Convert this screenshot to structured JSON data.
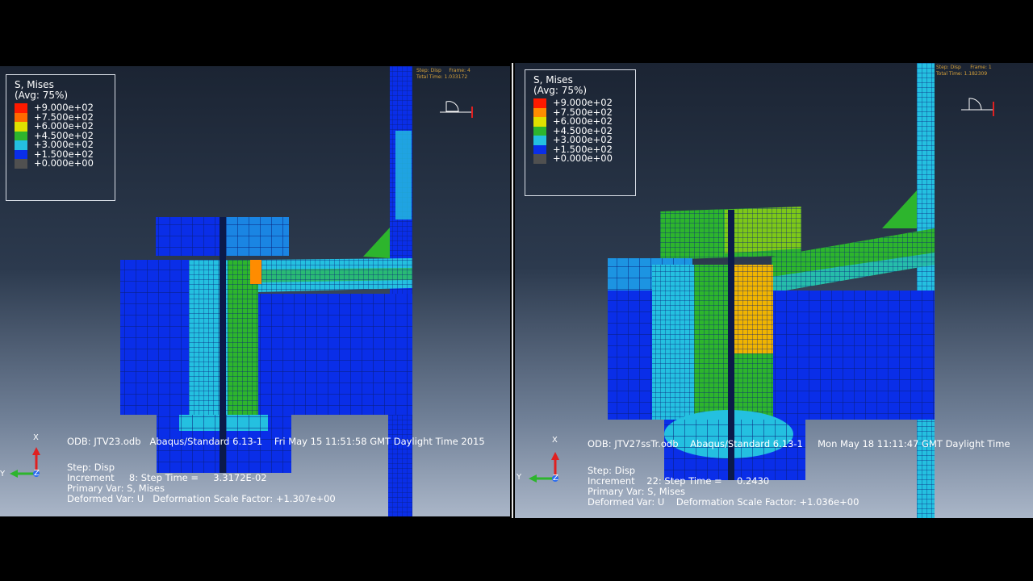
{
  "left": {
    "legend": {
      "title": "S, Mises",
      "subtitle": "(Avg: 75%)",
      "entries": [
        "+9.000e+02",
        "+7.500e+02",
        "+6.000e+02",
        "+4.500e+02",
        "+3.000e+02",
        "+1.500e+02",
        "+0.000e+00"
      ],
      "colors": [
        "#ff1a00",
        "#ff6a00",
        "#e0e000",
        "#2db52d",
        "#24c0e0",
        "#0a2ee8",
        "#505050"
      ]
    },
    "header": {
      "step": "Step: Disp     Frame: 4",
      "total": "Total Time: 1.033172"
    },
    "odb_line": "ODB: JTV23.odb   Abaqus/Standard 6.13-1    Fri May 15 11:51:58 GMT Daylight Time 2015",
    "step_line": "Step: Disp",
    "increment_line": "Increment     8: Step Time =     3.3172E-02",
    "primary_var": "Primary Var: S, Mises",
    "deformed_var": "Deformed Var: U   Deformation Scale Factor: +1.307e+00",
    "triad": {
      "x": "X",
      "y": "Y",
      "z": "Z"
    }
  },
  "right": {
    "legend": {
      "title": "S, Mises",
      "subtitle": "(Avg: 75%)",
      "entries": [
        "+9.000e+02",
        "+7.500e+02",
        "+6.000e+02",
        "+4.500e+02",
        "+3.000e+02",
        "+1.500e+02",
        "+0.000e+00"
      ],
      "colors": [
        "#ff1a00",
        "#ff8c00",
        "#e0e000",
        "#2db52d",
        "#24c0e0",
        "#0a2ee8",
        "#505050"
      ]
    },
    "header": {
      "step": "Step: Disp      Frame: 1",
      "total": "Total Time: 1.182309"
    },
    "odb_line": "ODB: JTV27ssTr.odb    Abaqus/Standard 6.13-1     Mon May 18 11:11:47 GMT Daylight Time",
    "step_line": "Step: Disp",
    "increment_line": "Increment    22: Step Time =     0.2430",
    "primary_var": "Primary Var: S, Mises",
    "deformed_var": "Deformed Var: U    Deformation Scale Factor: +1.036e+00",
    "triad": {
      "x": "X",
      "y": "Y",
      "z": "Z"
    }
  }
}
